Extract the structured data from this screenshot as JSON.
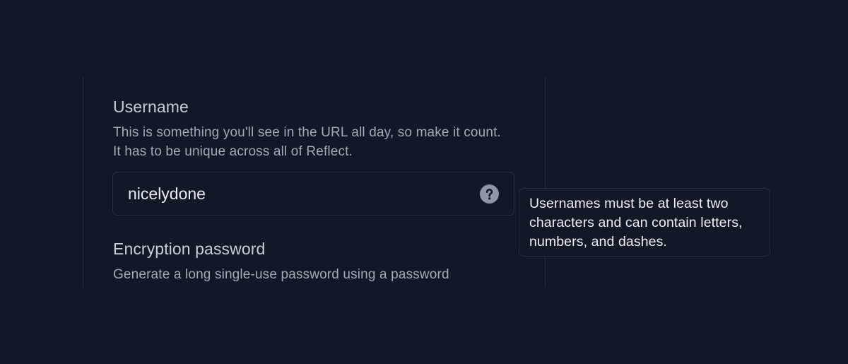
{
  "username_field": {
    "title": "Username",
    "description": "This is something you'll see in the URL all day, so make it count. It has to be unique across all of Reflect.",
    "value": "nicelydone",
    "help_icon": "question-mark-circle-icon"
  },
  "tooltip": {
    "text": "Usernames must be at least two characters and can contain letters, numbers, and dashes."
  },
  "password_field": {
    "title": "Encryption password",
    "description": "Generate a long single-use password using a password"
  },
  "colors": {
    "background": "#121826",
    "border": "#283040",
    "title_text": "#c9ced8",
    "body_text": "#a3aab6",
    "icon": "#8f97a6"
  }
}
